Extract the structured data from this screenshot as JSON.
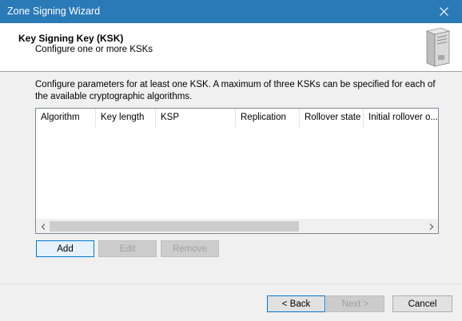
{
  "window": {
    "title": "Zone Signing Wizard"
  },
  "header": {
    "title": "Key Signing Key (KSK)",
    "subtitle": "Configure one or more KSKs",
    "icon": "server-icon"
  },
  "description": "Configure parameters for at least one KSK. A maximum of three KSKs can be specified for each of the available cryptographic algorithms.",
  "table": {
    "columns": [
      "Algorithm",
      "Key length",
      "KSP",
      "Replication",
      "Rollover state",
      "Initial rollover o..."
    ],
    "rows": []
  },
  "actions": {
    "add": "Add",
    "edit": "Edit",
    "remove": "Remove"
  },
  "nav": {
    "back": "< Back",
    "next": "Next >",
    "cancel": "Cancel"
  },
  "colors": {
    "titlebar": "#2b7ab8",
    "accent": "#0078d7"
  }
}
